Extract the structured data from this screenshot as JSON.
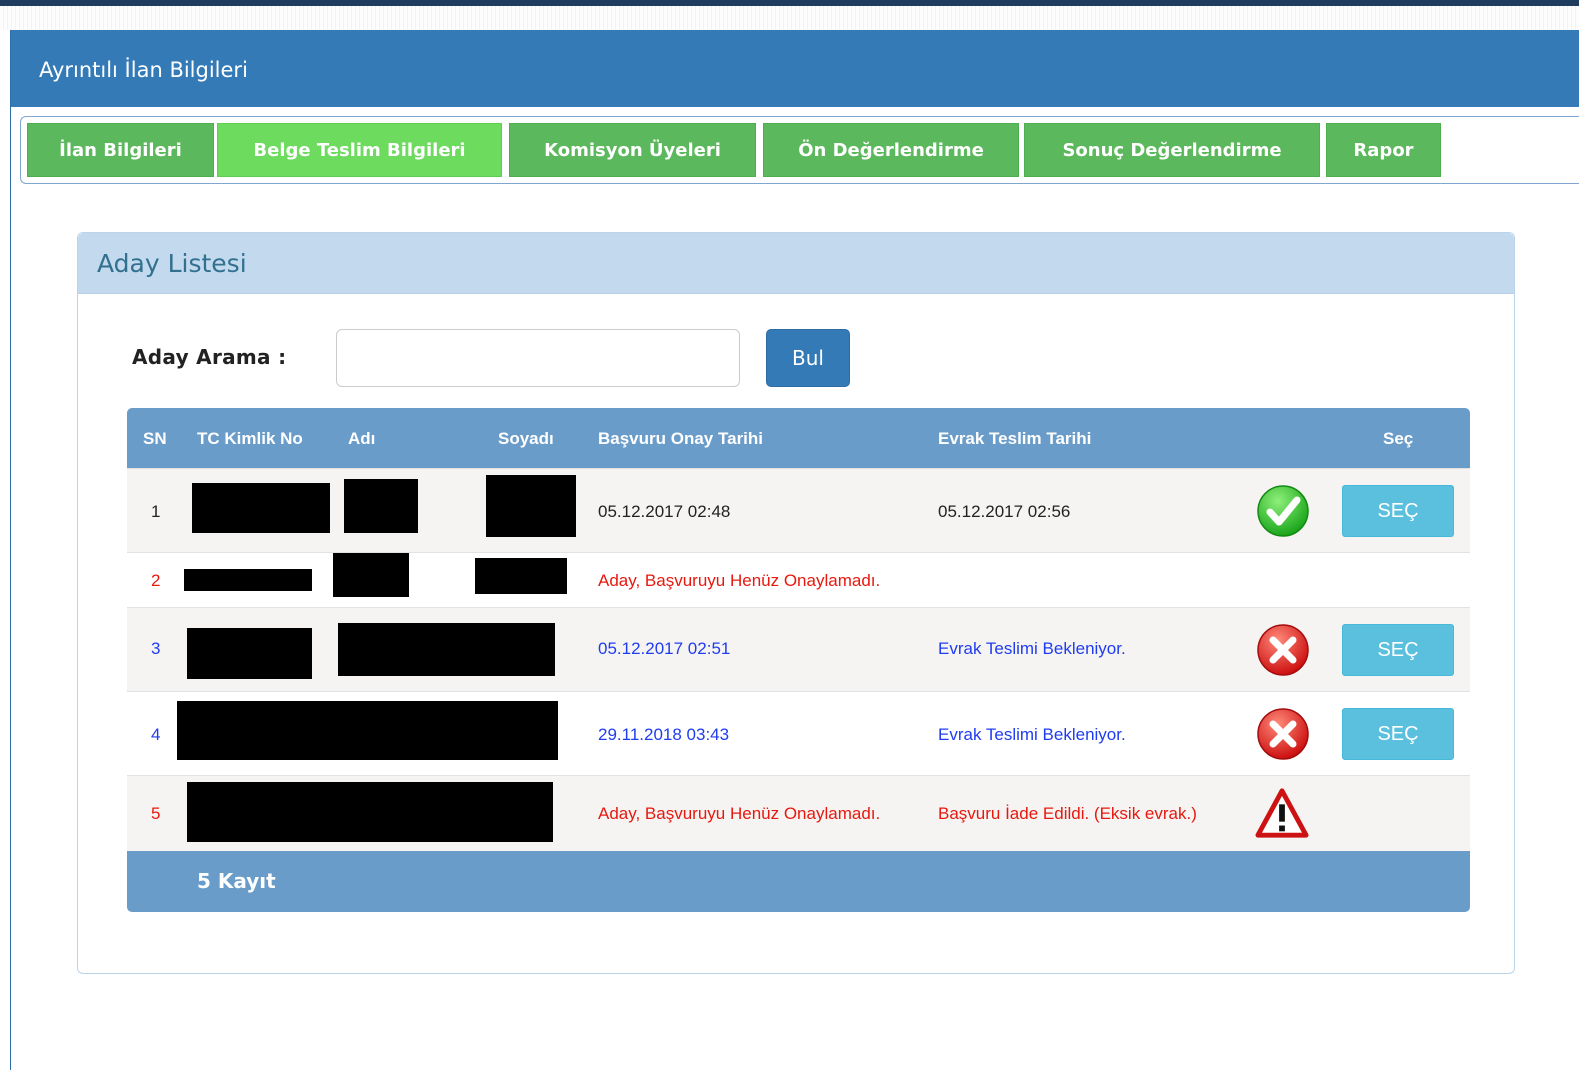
{
  "panel": {
    "title": "Ayrıntılı İlan Bilgileri"
  },
  "tabs": [
    {
      "label": "İlan Bilgileri",
      "active": false
    },
    {
      "label": "Belge Teslim Bilgileri",
      "active": true
    },
    {
      "label": "Komisyon Üyeleri",
      "active": false
    },
    {
      "label": "Ön Değerlendirme",
      "active": false
    },
    {
      "label": "Sonuç Değerlendirme",
      "active": false
    },
    {
      "label": "Rapor",
      "active": false
    }
  ],
  "card": {
    "title": "Aday Listesi"
  },
  "search": {
    "label": "Aday Arama :",
    "value": "",
    "placeholder": "",
    "button_label": "Bul"
  },
  "table": {
    "columns": [
      "SN",
      "TC Kimlik No",
      "Adı",
      "Soyadı",
      "Başvuru Onay Tarihi",
      "Evrak Teslim Tarihi",
      "Seç"
    ],
    "rows": [
      {
        "sn": "1",
        "onay": "05.12.2017 02:48",
        "evrak": "05.12.2017 02:56",
        "status": "check-icon",
        "button": "SEÇ",
        "color": "black"
      },
      {
        "sn": "2",
        "onay": "Aday, Başvuruyu Henüz Onaylamadı.",
        "evrak": "",
        "status": "",
        "button": "",
        "color": "red"
      },
      {
        "sn": "3",
        "onay": "05.12.2017 02:51",
        "evrak": "Evrak Teslimi Bekleniyor.",
        "status": "cross-icon",
        "button": "SEÇ",
        "color": "blue"
      },
      {
        "sn": "4",
        "onay": "29.11.2018 03:43",
        "evrak": "Evrak Teslimi Bekleniyor.",
        "status": "cross-icon",
        "button": "SEÇ",
        "color": "blue"
      },
      {
        "sn": "5",
        "onay": "Aday, Başvuruyu Henüz Onaylamadı.",
        "evrak": "Başvuru İade Edildi. (Eksik evrak.)",
        "status": "warning-icon",
        "button": "",
        "color": "red"
      }
    ],
    "footer": "5 Kayıt"
  },
  "colors": {
    "header_blue": "#337ab7",
    "tab_green": "#5cb85c",
    "tab_active_green": "#6cdb5e",
    "grid_head": "#6a9cc9",
    "select_button": "#5bc0de",
    "text_red": "#e8180f",
    "text_blue": "#1f3cf0"
  }
}
